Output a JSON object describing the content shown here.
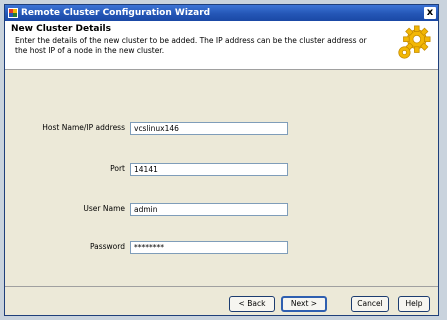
{
  "window": {
    "title": "Remote Cluster Configuration Wizard",
    "close_glyph": "x"
  },
  "header": {
    "title": "New Cluster Details",
    "description": "Enter the details of the new cluster to be added. The IP address can be the cluster address or the host IP of a node in the new cluster.",
    "icon": "gear-icon"
  },
  "form": {
    "host": {
      "label": "Host Name/IP address",
      "value": "vcslinux146"
    },
    "port": {
      "label": "Port",
      "value": "14141"
    },
    "user": {
      "label": "User Name",
      "value": "admin"
    },
    "password": {
      "label": "Password",
      "value": "********"
    }
  },
  "buttons": {
    "back": "< Back",
    "next": "Next >",
    "cancel": "Cancel",
    "help": "Help"
  },
  "colors": {
    "titlebar": "#2456b6",
    "dialog_bg": "#ece9d8",
    "header_bg": "#ffffff",
    "gear": "#f2b705"
  }
}
